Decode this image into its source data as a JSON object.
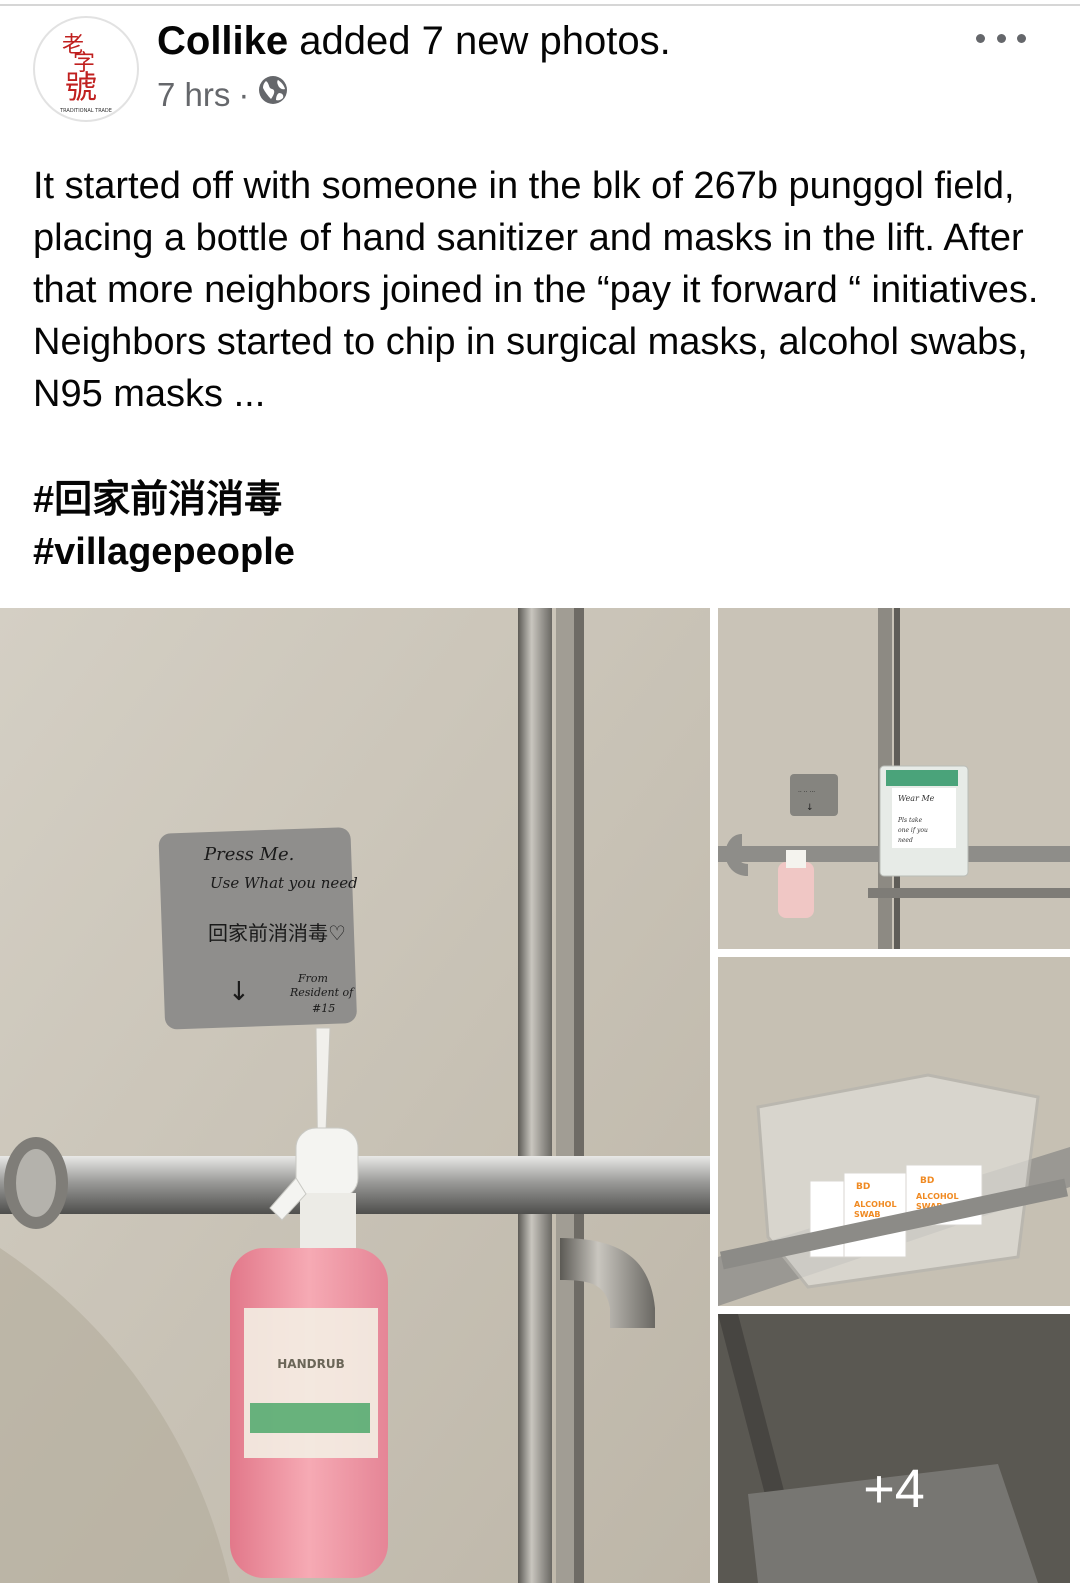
{
  "post": {
    "author": "Collike",
    "action": " added 7 new photos.",
    "time": "7 hrs",
    "separator": "·",
    "audience_icon": "globe-icon",
    "body": "It started off with someone in the blk of 267b punggol field, placing a bottle of hand sanitizer and masks in the lift. After that more neighbors joined in the “pay it forward “ initiatives. Neighbors started to chip in surgical masks, alcohol swabs, N95 masks ...",
    "hashtags": [
      "#回家前消消毒",
      "#villagepeople"
    ]
  },
  "avatar": {
    "logo_text": "老字號",
    "logo_subtext": "TRADITIONAL TRADE",
    "accent_color": "#c0201f"
  },
  "photos": {
    "main": {
      "note_lines": [
        "Press Me.",
        "Use What you need",
        "回家前消消毒♡",
        "From",
        "Resident of",
        "#15"
      ],
      "bottle_label": "HANDRUB"
    },
    "second": {
      "card_lines": [
        "Wear Me",
        "Pls take",
        "one if you",
        "need"
      ]
    },
    "third": {
      "swab_brand": "BD",
      "swab_lines": [
        "ALCOHOL",
        "SWAB"
      ]
    },
    "more_count": "+4"
  },
  "colors": {
    "text": "#050505",
    "meta": "#65676b",
    "wall": "#cfc9bd",
    "sanitizer": "#f29aa5"
  }
}
